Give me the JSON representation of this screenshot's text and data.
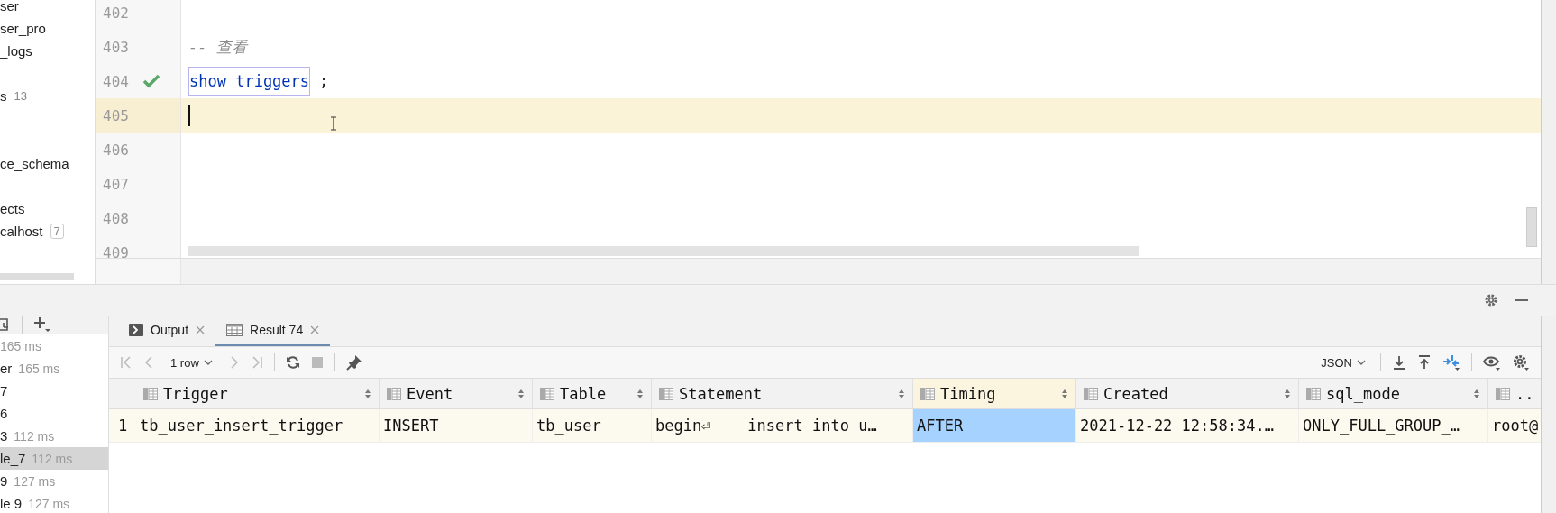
{
  "sidebar": {
    "items": [
      {
        "label": "ser"
      },
      {
        "label": "ser_pro"
      },
      {
        "label": "_logs"
      },
      {
        "label": "s",
        "count": "13"
      },
      {
        "label": "ce_schema"
      },
      {
        "label": "ects"
      },
      {
        "label": "calhost",
        "badge": "7"
      }
    ]
  },
  "editor": {
    "lines": [
      {
        "number": "402",
        "current": false
      },
      {
        "number": "403",
        "current": false,
        "code": [
          {
            "kind": "comment",
            "text": "-- 查看"
          }
        ]
      },
      {
        "number": "404",
        "current": false,
        "executed": true,
        "code": [
          {
            "kind": "keyword",
            "text": "show triggers",
            "boxed": true
          },
          {
            "kind": "plain",
            "text": ";"
          }
        ]
      },
      {
        "number": "405",
        "current": true
      },
      {
        "number": "406",
        "current": false
      },
      {
        "number": "407",
        "current": false
      },
      {
        "number": "408",
        "current": false
      },
      {
        "number": "409",
        "current": false
      }
    ]
  },
  "history": {
    "items": [
      {
        "time": "165 ms",
        "selected": false
      },
      {
        "label": "er",
        "time": "165 ms",
        "selected": false
      },
      {
        "label": "7",
        "selected": false
      },
      {
        "label": "6",
        "selected": false
      },
      {
        "label": "3",
        "time": "112 ms",
        "selected": false
      },
      {
        "label": "le_7",
        "time": "112 ms",
        "selected": true
      },
      {
        "label": "9",
        "time": "127 ms",
        "selected": false
      },
      {
        "label": "le 9",
        "time": "127 ms",
        "selected": false
      }
    ]
  },
  "tabs": [
    {
      "label": "Output",
      "kind": "console",
      "selected": false
    },
    {
      "label": "Result 74",
      "kind": "table",
      "selected": true
    }
  ],
  "toolbar": {
    "rows": "1 row",
    "format": "JSON"
  },
  "table": {
    "columns": [
      {
        "label": "Trigger",
        "selected": false
      },
      {
        "label": "Event",
        "selected": false
      },
      {
        "label": "Table",
        "selected": false
      },
      {
        "label": "Statement",
        "selected": false
      },
      {
        "label": "Timing",
        "selected": true
      },
      {
        "label": "Created",
        "selected": false
      },
      {
        "label": "sql_mode",
        "selected": false
      },
      {
        "label": "..",
        "selected": false
      }
    ],
    "rows": [
      {
        "number": "1",
        "cells": [
          {
            "text": "tb_user_insert_trigger",
            "selected": false
          },
          {
            "text": "INSERT",
            "selected": false
          },
          {
            "text": "tb_user",
            "selected": false
          },
          {
            "text": "begin⏎    insert into u…",
            "selected": false
          },
          {
            "text": "AFTER",
            "selected": true
          },
          {
            "text": "2021-12-22 12:58:34.…",
            "selected": false
          },
          {
            "text": "ONLY_FULL_GROUP_…",
            "selected": false
          },
          {
            "text": "root@",
            "selected": false
          }
        ]
      }
    ]
  }
}
